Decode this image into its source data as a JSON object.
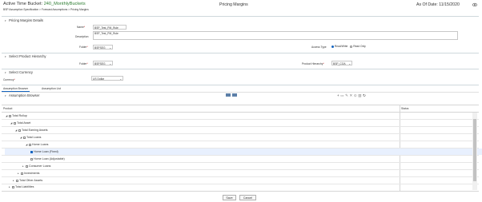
{
  "header": {
    "bucket_prefix": "Active Time Bucket:",
    "bucket_name": "240_MonthlyBuckets",
    "breadcrumb": "BSP Assumption Specification > Forecast Assumptions > Pricing Margins",
    "title": "Pricing Margins",
    "as_of_label": "As Of Date:",
    "as_of_date": "11/15/2020"
  },
  "details": {
    "section_title": "Pricing Margins Details",
    "name_label": "Name",
    "name_value": "BSP_Test_PM_Rule",
    "description_label": "Description",
    "description_value": "BSP_Test_PM_Rule",
    "folder_label": "Folder",
    "folder_value": "BSPSEG",
    "access_type_label": "Access Type",
    "access_read_write": "Read/Write",
    "access_read_only": "Read Only"
  },
  "hierarchy": {
    "section_title": "Select Product Hierarchy",
    "folder_label": "Folder",
    "folder_value": "BSPSEG",
    "product_hierarchy_label": "Product Hierarchy",
    "product_hierarchy_value": "BSP_COA"
  },
  "currency": {
    "section_title": "Select Currency",
    "currency_label": "Currency",
    "currency_value": "US Dollar"
  },
  "tabs": [
    {
      "label": "Assumption Browser"
    },
    {
      "label": "Assumption List"
    }
  ],
  "browser": {
    "section_title": "Assumption Browser",
    "col_product": "Product",
    "col_status": "Status"
  },
  "tree": [
    {
      "label": "Total Rollup",
      "expand": "down"
    },
    {
      "label": "Total Asset",
      "expand": "down"
    },
    {
      "label": "Total Earning Assets",
      "expand": "down"
    },
    {
      "label": "Total Loans",
      "expand": "down"
    },
    {
      "label": "Home Loans",
      "expand": "down"
    },
    {
      "label": "Home Loan (Fixed)",
      "expand": ""
    },
    {
      "label": "Home Loan (Adjustable)",
      "expand": ""
    },
    {
      "label": "Consumer Loans",
      "expand": "right"
    },
    {
      "label": "Investments",
      "expand": "right"
    },
    {
      "label": "Total Other Assets",
      "expand": "right"
    },
    {
      "label": "Total Liabilities",
      "expand": "right"
    }
  ],
  "footer": {
    "save_label": "Save",
    "cancel_label": "Cancel"
  },
  "colors": {
    "accent": "#1565c0",
    "bucket_green": "#2e7d32",
    "selected_row": "#e8f0fe"
  }
}
